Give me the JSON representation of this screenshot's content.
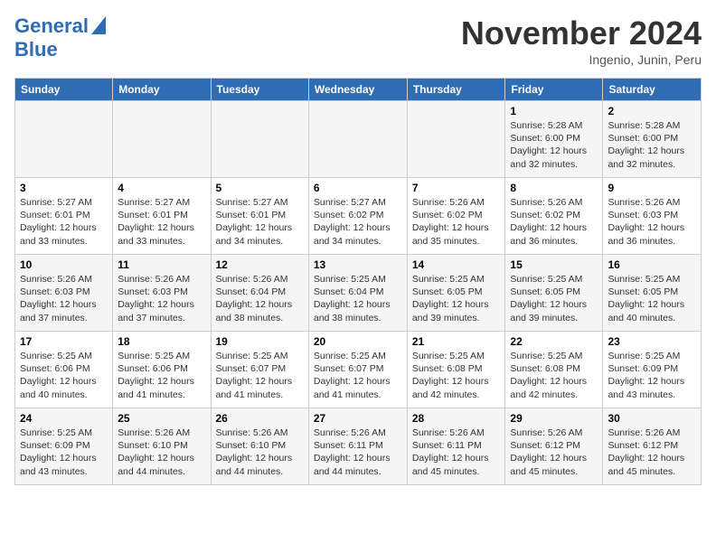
{
  "header": {
    "logo_line1": "General",
    "logo_line2": "Blue",
    "month": "November 2024",
    "location": "Ingenio, Junin, Peru"
  },
  "days_of_week": [
    "Sunday",
    "Monday",
    "Tuesday",
    "Wednesday",
    "Thursday",
    "Friday",
    "Saturday"
  ],
  "weeks": [
    [
      {
        "day": "",
        "info": ""
      },
      {
        "day": "",
        "info": ""
      },
      {
        "day": "",
        "info": ""
      },
      {
        "day": "",
        "info": ""
      },
      {
        "day": "",
        "info": ""
      },
      {
        "day": "1",
        "info": "Sunrise: 5:28 AM\nSunset: 6:00 PM\nDaylight: 12 hours and 32 minutes."
      },
      {
        "day": "2",
        "info": "Sunrise: 5:28 AM\nSunset: 6:00 PM\nDaylight: 12 hours and 32 minutes."
      }
    ],
    [
      {
        "day": "3",
        "info": "Sunrise: 5:27 AM\nSunset: 6:01 PM\nDaylight: 12 hours and 33 minutes."
      },
      {
        "day": "4",
        "info": "Sunrise: 5:27 AM\nSunset: 6:01 PM\nDaylight: 12 hours and 33 minutes."
      },
      {
        "day": "5",
        "info": "Sunrise: 5:27 AM\nSunset: 6:01 PM\nDaylight: 12 hours and 34 minutes."
      },
      {
        "day": "6",
        "info": "Sunrise: 5:27 AM\nSunset: 6:02 PM\nDaylight: 12 hours and 34 minutes."
      },
      {
        "day": "7",
        "info": "Sunrise: 5:26 AM\nSunset: 6:02 PM\nDaylight: 12 hours and 35 minutes."
      },
      {
        "day": "8",
        "info": "Sunrise: 5:26 AM\nSunset: 6:02 PM\nDaylight: 12 hours and 36 minutes."
      },
      {
        "day": "9",
        "info": "Sunrise: 5:26 AM\nSunset: 6:03 PM\nDaylight: 12 hours and 36 minutes."
      }
    ],
    [
      {
        "day": "10",
        "info": "Sunrise: 5:26 AM\nSunset: 6:03 PM\nDaylight: 12 hours and 37 minutes."
      },
      {
        "day": "11",
        "info": "Sunrise: 5:26 AM\nSunset: 6:03 PM\nDaylight: 12 hours and 37 minutes."
      },
      {
        "day": "12",
        "info": "Sunrise: 5:26 AM\nSunset: 6:04 PM\nDaylight: 12 hours and 38 minutes."
      },
      {
        "day": "13",
        "info": "Sunrise: 5:25 AM\nSunset: 6:04 PM\nDaylight: 12 hours and 38 minutes."
      },
      {
        "day": "14",
        "info": "Sunrise: 5:25 AM\nSunset: 6:05 PM\nDaylight: 12 hours and 39 minutes."
      },
      {
        "day": "15",
        "info": "Sunrise: 5:25 AM\nSunset: 6:05 PM\nDaylight: 12 hours and 39 minutes."
      },
      {
        "day": "16",
        "info": "Sunrise: 5:25 AM\nSunset: 6:05 PM\nDaylight: 12 hours and 40 minutes."
      }
    ],
    [
      {
        "day": "17",
        "info": "Sunrise: 5:25 AM\nSunset: 6:06 PM\nDaylight: 12 hours and 40 minutes."
      },
      {
        "day": "18",
        "info": "Sunrise: 5:25 AM\nSunset: 6:06 PM\nDaylight: 12 hours and 41 minutes."
      },
      {
        "day": "19",
        "info": "Sunrise: 5:25 AM\nSunset: 6:07 PM\nDaylight: 12 hours and 41 minutes."
      },
      {
        "day": "20",
        "info": "Sunrise: 5:25 AM\nSunset: 6:07 PM\nDaylight: 12 hours and 41 minutes."
      },
      {
        "day": "21",
        "info": "Sunrise: 5:25 AM\nSunset: 6:08 PM\nDaylight: 12 hours and 42 minutes."
      },
      {
        "day": "22",
        "info": "Sunrise: 5:25 AM\nSunset: 6:08 PM\nDaylight: 12 hours and 42 minutes."
      },
      {
        "day": "23",
        "info": "Sunrise: 5:25 AM\nSunset: 6:09 PM\nDaylight: 12 hours and 43 minutes."
      }
    ],
    [
      {
        "day": "24",
        "info": "Sunrise: 5:25 AM\nSunset: 6:09 PM\nDaylight: 12 hours and 43 minutes."
      },
      {
        "day": "25",
        "info": "Sunrise: 5:26 AM\nSunset: 6:10 PM\nDaylight: 12 hours and 44 minutes."
      },
      {
        "day": "26",
        "info": "Sunrise: 5:26 AM\nSunset: 6:10 PM\nDaylight: 12 hours and 44 minutes."
      },
      {
        "day": "27",
        "info": "Sunrise: 5:26 AM\nSunset: 6:11 PM\nDaylight: 12 hours and 44 minutes."
      },
      {
        "day": "28",
        "info": "Sunrise: 5:26 AM\nSunset: 6:11 PM\nDaylight: 12 hours and 45 minutes."
      },
      {
        "day": "29",
        "info": "Sunrise: 5:26 AM\nSunset: 6:12 PM\nDaylight: 12 hours and 45 minutes."
      },
      {
        "day": "30",
        "info": "Sunrise: 5:26 AM\nSunset: 6:12 PM\nDaylight: 12 hours and 45 minutes."
      }
    ]
  ]
}
